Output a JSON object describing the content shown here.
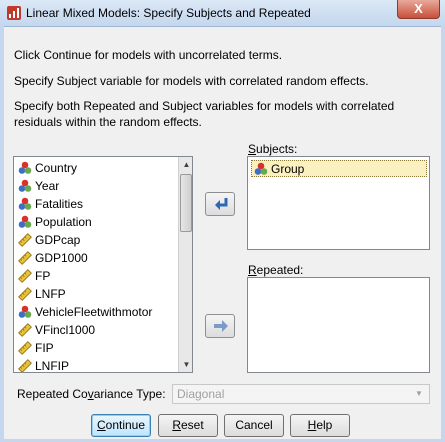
{
  "window": {
    "title": "Linear Mixed Models: Specify Subjects and Repeated",
    "close_label": "X"
  },
  "instructions": [
    "Click Continue for models with uncorrelated terms.",
    "Specify Subject variable for models with correlated random effects.",
    "Specify both Repeated and Subject variables for models with correlated",
    "residuals within the random effects."
  ],
  "variables": [
    {
      "label": "Country",
      "icon": "nominal-icon"
    },
    {
      "label": "Year",
      "icon": "nominal-icon"
    },
    {
      "label": "Fatalities",
      "icon": "nominal-icon"
    },
    {
      "label": "Population",
      "icon": "nominal-icon"
    },
    {
      "label": "GDPcap",
      "icon": "scale-ruler-icon"
    },
    {
      "label": "GDP1000",
      "icon": "scale-ruler-icon"
    },
    {
      "label": "FP",
      "icon": "scale-ruler-icon"
    },
    {
      "label": "LNFP",
      "icon": "scale-ruler-icon"
    },
    {
      "label": "VehicleFleetwithmotor",
      "icon": "nominal-icon"
    },
    {
      "label": "VFincl1000",
      "icon": "scale-ruler-icon"
    },
    {
      "label": "FIP",
      "icon": "scale-ruler-icon"
    },
    {
      "label": "LNFIP",
      "icon": "scale-ruler-icon"
    }
  ],
  "subjects": {
    "label_pre": "",
    "label_mnemonic": "S",
    "label_post": "ubjects:",
    "items": [
      {
        "label": "Group",
        "icon": "nominal-icon"
      }
    ]
  },
  "repeated": {
    "label_pre": "",
    "label_mnemonic": "R",
    "label_post": "epeated:",
    "items": []
  },
  "covariance": {
    "label_pre": "Repeated Co",
    "label_mnemonic": "v",
    "label_post": "ariance Type:",
    "value": "Diagonal"
  },
  "buttons": {
    "continue": {
      "pre": "",
      "mnemonic": "C",
      "post": "ontinue"
    },
    "reset": {
      "pre": "",
      "mnemonic": "R",
      "post": "eset"
    },
    "cancel": "Cancel",
    "help": {
      "pre": "",
      "mnemonic": "H",
      "post": "elp"
    }
  },
  "colors": {
    "nominal_red": "#d8322a",
    "nominal_blue": "#3f6fbf",
    "nominal_green": "#6aa84f",
    "scale_yellow": "#e8c23a",
    "arrow_blue": "#2c69b4"
  }
}
